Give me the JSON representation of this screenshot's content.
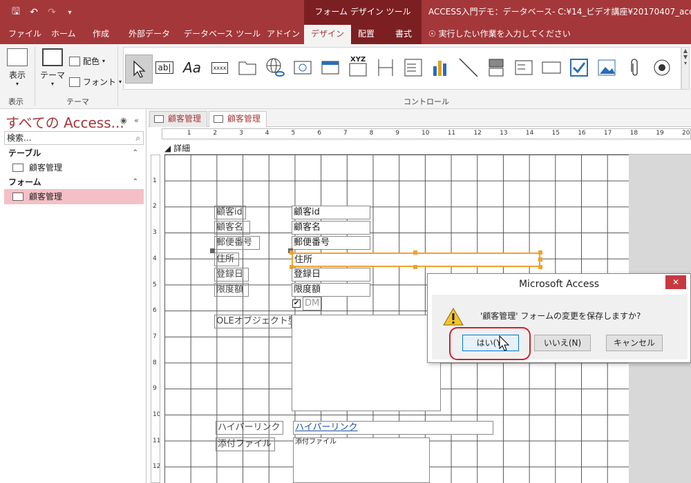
{
  "window": {
    "qat_save_icon": "save-icon",
    "qat_undo_icon": "undo-icon",
    "qat_redo_icon": "redo-icon",
    "context_tools": "フォーム デザイン ツール",
    "doc_title": "ACCESS入門デモ：データベース- C:¥14_ビデオ講座¥20170407_access入"
  },
  "tabs": [
    {
      "label": "ファイル"
    },
    {
      "label": "ホーム"
    },
    {
      "label": "作成"
    },
    {
      "label": "外部データ"
    },
    {
      "label": "データベース ツール"
    },
    {
      "label": "アドイン"
    },
    {
      "label": "デザイン"
    },
    {
      "label": "配置"
    },
    {
      "label": "書式"
    }
  ],
  "tell_me": "実行したい作業を入力してください",
  "ribbon": {
    "view_label": "表示",
    "view_group": "表示",
    "theme_label": "テーマ",
    "color_label": "配色",
    "font_label": "フォント",
    "theme_group": "テーマ",
    "controls_group": "コントロール",
    "ctl_text_ab": "ab|",
    "ctl_label_aa": "Aa",
    "ctl_button_xxxx": "xxxx",
    "ctl_option_xyz": "XYZ"
  },
  "nav": {
    "title": "すべての Access...",
    "search_placeholder": "検索...",
    "tables_header": "テーブル",
    "table_item": "顧客管理",
    "forms_header": "フォーム",
    "form_item": "顧客管理"
  },
  "doctabs": [
    {
      "label": "顧客管理"
    },
    {
      "label": "顧客管理"
    }
  ],
  "ruler": {
    "h": [
      "1",
      "2",
      "3",
      "4",
      "5",
      "6",
      "7",
      "8",
      "9",
      "10",
      "11",
      "12",
      "13",
      "14",
      "15",
      "16",
      "17",
      "18",
      "19",
      "20"
    ],
    "v": [
      "1",
      "2",
      "3",
      "4",
      "5",
      "6",
      "7",
      "8",
      "9",
      "10",
      "11",
      "12"
    ]
  },
  "section": "詳細",
  "form": {
    "lbl_id": "顧客id",
    "box_id": "顧客id",
    "lbl_name": "顧客名",
    "box_name": "顧客名",
    "lbl_zip": "郵便番号",
    "box_zip": "郵便番号",
    "lbl_addr": "住所",
    "box_addr": "住所",
    "lbl_date": "登録日",
    "box_date": "登録日",
    "lbl_limit": "限度額",
    "box_limit": "限度額",
    "chk_dm": "DM",
    "lbl_ole": "OLEオブジェクト型",
    "lbl_link": "ハイパーリンク",
    "box_link": "ハイパーリンク",
    "lbl_attach": "添付ファイル",
    "box_attach": "添付ファイル"
  },
  "dialog": {
    "title": "Microsoft Access",
    "message": "'顧客管理' フォームの変更を保存しますか?",
    "yes": "はい(Y)",
    "no": "いいえ(N)",
    "cancel": "キャンセル"
  },
  "colors": {
    "accent": "#a4373a",
    "highlight": "#d21f2b",
    "selection": "#f0a030"
  }
}
